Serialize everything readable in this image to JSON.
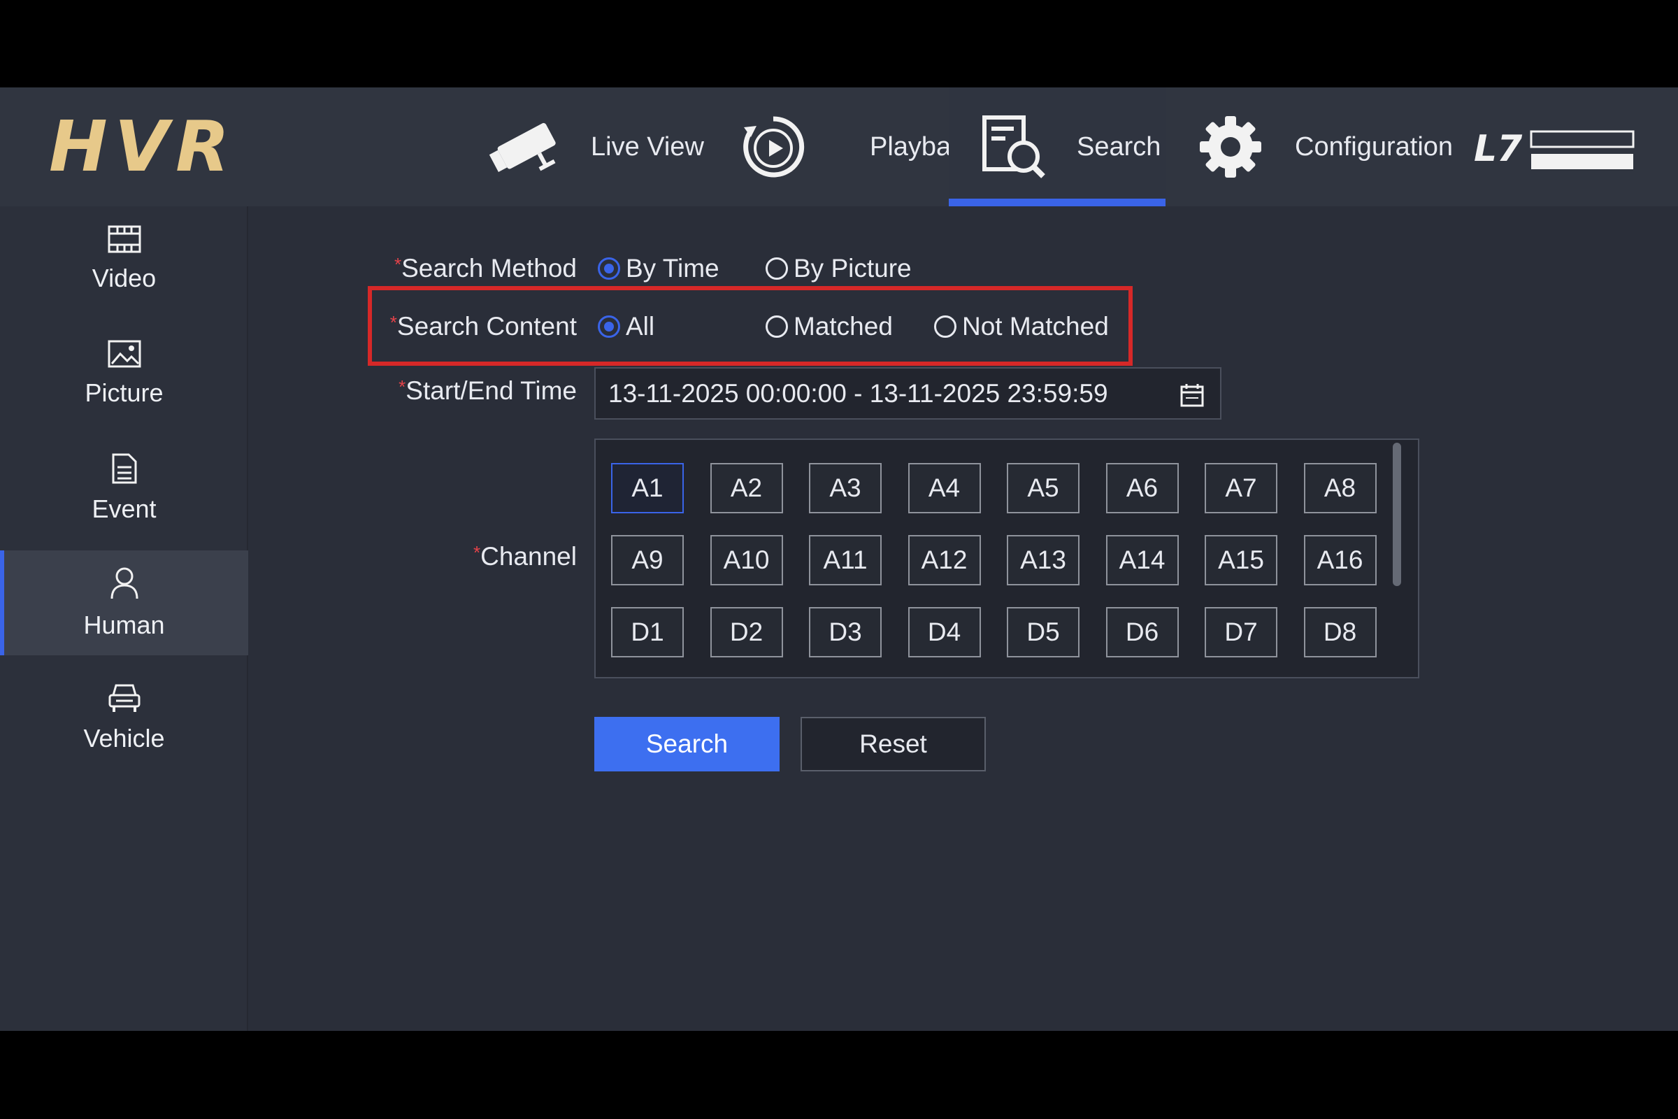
{
  "header": {
    "logo": "HVR",
    "nav": [
      {
        "label": "Live View",
        "icon": "camera-icon"
      },
      {
        "label": "Playback",
        "icon": "playback-icon"
      },
      {
        "label": "Search",
        "icon": "search-document-icon",
        "active": true
      },
      {
        "label": "Configuration",
        "icon": "gear-icon"
      }
    ],
    "brand_icon": "hikvisionland-logo",
    "accent_color": "#3a64e8"
  },
  "sidebar": {
    "items": [
      {
        "label": "Video",
        "icon": "film-icon"
      },
      {
        "label": "Picture",
        "icon": "image-icon"
      },
      {
        "label": "Event",
        "icon": "document-icon"
      },
      {
        "label": "Human",
        "icon": "person-icon",
        "active": true
      },
      {
        "label": "Vehicle",
        "icon": "car-icon"
      }
    ]
  },
  "form": {
    "required_mark": "*",
    "search_method": {
      "label": "Search Method",
      "options": [
        "By Time",
        "By Picture"
      ],
      "selected": "By Time"
    },
    "search_content": {
      "label": "Search Content",
      "options": [
        "All",
        "Matched",
        "Not Matched"
      ],
      "selected": "All"
    },
    "start_end_time": {
      "label": "Start/End Time",
      "value": "13-11-2025 00:00:00 - 13-11-2025 23:59:59"
    },
    "channel": {
      "label": "Channel",
      "rows": [
        [
          "A1",
          "A2",
          "A3",
          "A4",
          "A5",
          "A6",
          "A7",
          "A8"
        ],
        [
          "A9",
          "A10",
          "A11",
          "A12",
          "A13",
          "A14",
          "A15",
          "A16"
        ],
        [
          "D1",
          "D2",
          "D3",
          "D4",
          "D5",
          "D6",
          "D7",
          "D8"
        ]
      ],
      "selected": "A1"
    },
    "search_button": "Search",
    "reset_button": "Reset"
  }
}
